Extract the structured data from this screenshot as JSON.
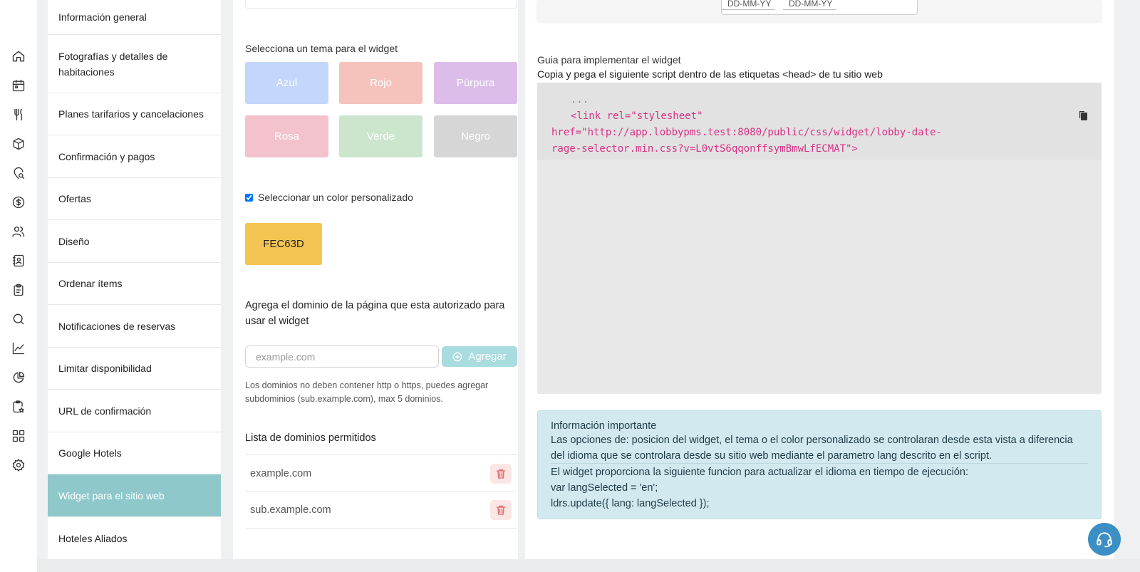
{
  "rail_icons": [
    "home-icon",
    "calendar-icon",
    "utensils-icon",
    "box-icon",
    "location-search-icon",
    "dollar-icon",
    "users-icon",
    "contacts-icon",
    "clipboard-icon",
    "search-icon",
    "chart-line-icon",
    "pie-chart-icon",
    "clipboard-star-icon",
    "grid-icon",
    "gear-icon"
  ],
  "nav": {
    "items": [
      {
        "label": "Información general"
      },
      {
        "label": "Fotografías y detalles de habitaciones"
      },
      {
        "label": "Planes tarifarios y cancelaciones"
      },
      {
        "label": "Confirmación y pagos"
      },
      {
        "label": "Ofertas"
      },
      {
        "label": "Diseño"
      },
      {
        "label": "Ordenar ítems"
      },
      {
        "label": "Notificaciones de reservas"
      },
      {
        "label": "Limitar disponibilidad"
      },
      {
        "label": "URL de confirmación"
      },
      {
        "label": "Google Hotels"
      },
      {
        "label": "Widget para el sitio web"
      },
      {
        "label": "Hoteles Aliados"
      }
    ],
    "active_index": 11
  },
  "theme_section": {
    "title": "Selecciona un tema para el widget",
    "themes": [
      {
        "label": "Azul",
        "color": "#c3d6fb"
      },
      {
        "label": "Rojo",
        "color": "#f5c3bc"
      },
      {
        "label": "Púrpura",
        "color": "#dcbdea"
      },
      {
        "label": "Rosa",
        "color": "#f3c2cd"
      },
      {
        "label": "Verde",
        "color": "#cce6cd"
      },
      {
        "label": "Negro",
        "color": "#d6d6d6"
      }
    ],
    "custom_color_label": "Seleccionar un color personalizado",
    "custom_color_checked": true,
    "custom_color_value": "FEC63D"
  },
  "domain_section": {
    "title": "Agrega el dominio de la página que esta autorizado para usar el widget",
    "input_placeholder": "example.com",
    "add_label": "Agregar",
    "hint": "Los dominios no deben contener http o https, puedes agregar subdominios (sub.example.com), max 5 dominios.",
    "list_title": "Lista de dominios permitidos",
    "domains": [
      "example.com",
      "sub.example.com"
    ]
  },
  "date_picker": {
    "placeholder_start": "DD-MM-YY",
    "placeholder_end": "DD-MM-YY"
  },
  "guide": {
    "title": "Guia para implementar el widget",
    "instruction": "Copia y pega el siguiente script dentro de las etiquetas <head> de tu sitio web",
    "code_lines": [
      "...",
      "<link rel=\"stylesheet\"",
      "href=\"http://app.lobbypms.test:8080/public/css/widget/lobby-date-",
      "rage-selector.min.css?v=L0vtS6qqonffsymBmwLfECMAT\">"
    ]
  },
  "info": {
    "title": "Información importante",
    "para1": "Las opciones de: posicion del widget, el tema o el color personalizado se controlaran desde esta vista a diferencia del idioma que se controlara desde su sitio web mediante el parametro lang descrito en el script.",
    "para2": "El widget proporciona la siguiente funcion para actualizar el idioma en tiempo de ejecución:",
    "code1": "var langSelected = 'en';",
    "code2": "ldrs.update({ lang: langSelected });"
  }
}
